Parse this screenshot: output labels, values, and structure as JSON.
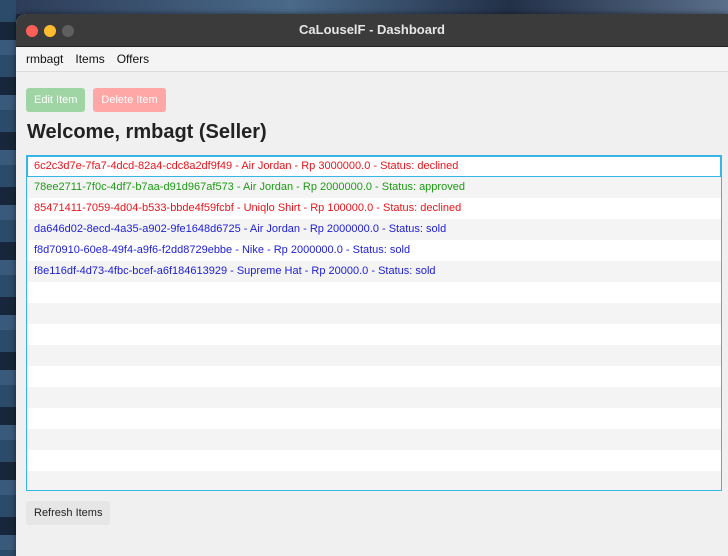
{
  "window": {
    "title": "CaLouselF - Dashboard"
  },
  "menu": {
    "items": [
      "rmbagt",
      "Items",
      "Offers"
    ]
  },
  "toolbar": {
    "edit_label": "Edit Item",
    "delete_label": "Delete Item"
  },
  "welcome": "Welcome, rmbagt (Seller)",
  "items": [
    {
      "text": "6c2c3d7e-7fa7-4dcd-82a4-cdc8a2df9f49 - Air Jordan - Rp 3000000.0 - Status: declined",
      "color": "#e8141b"
    },
    {
      "text": "78ee2711-7f0c-4df7-b7aa-d91d967af573 - Air Jordan - Rp 2000000.0 - Status: approved",
      "color": "#1f9a16"
    },
    {
      "text": "85471411-7059-4d04-b533-bbde4f59fcbf - Uniqlo Shirt - Rp 100000.0 - Status: declined",
      "color": "#e8141b"
    },
    {
      "text": "da646d02-8ecd-4a35-a902-9fe1648d6725 - Air Jordan - Rp 2000000.0 - Status: sold",
      "color": "#2020d8"
    },
    {
      "text": "f8d70910-60e8-49f4-a9f6-f2dd8729ebbe - Nike - Rp 2000000.0 - Status: sold",
      "color": "#2020d8"
    },
    {
      "text": "f8e116df-4d73-4fbc-bcef-a6f184613929 - Supreme Hat - Rp 20000.0 - Status: sold",
      "color": "#2020d8"
    }
  ],
  "refresh_label": "Refresh Items"
}
